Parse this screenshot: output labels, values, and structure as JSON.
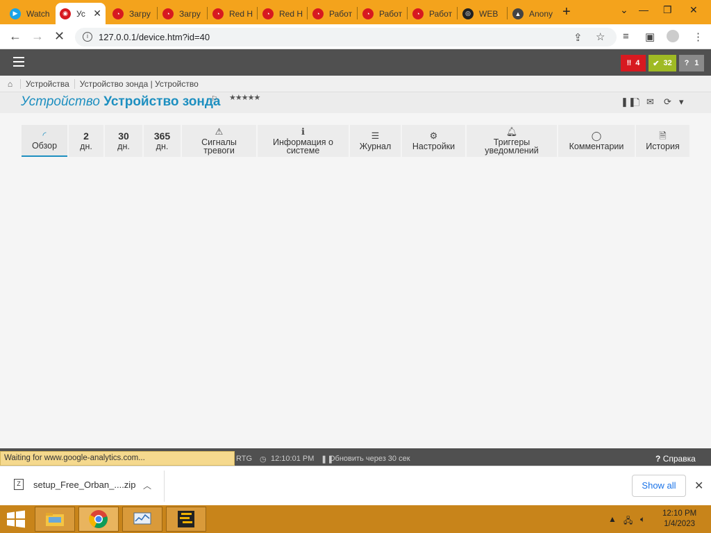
{
  "browser": {
    "tabs": [
      {
        "label": "Watch",
        "icon": "play-icon",
        "color": "#1aa3e8"
      },
      {
        "label": "Ус",
        "icon": "prtg-icon",
        "color": "#d71920"
      },
      {
        "label": "Загру",
        "icon": "prtg-icon",
        "color": "#d71920"
      },
      {
        "label": "Загру",
        "icon": "prtg-icon",
        "color": "#d71920"
      },
      {
        "label": "Red H",
        "icon": "prtg-icon",
        "color": "#d71920"
      },
      {
        "label": "Red H",
        "icon": "prtg-icon",
        "color": "#d71920"
      },
      {
        "label": "Работ",
        "icon": "prtg-icon",
        "color": "#d71920"
      },
      {
        "label": "Работ",
        "icon": "prtg-icon",
        "color": "#d71920"
      },
      {
        "label": "Работ",
        "icon": "prtg-icon",
        "color": "#d71920"
      },
      {
        "label": "WEB",
        "icon": "eye-icon",
        "color": "#222222"
      },
      {
        "label": "Anony",
        "icon": "anon-icon",
        "color": "#444444"
      }
    ],
    "url": "127.0.0.1/device.htm?id=40"
  },
  "header": {
    "alarms": {
      "down": "4",
      "up": "32",
      "unknown": "1"
    }
  },
  "breadcrumb": [
    "Устройства",
    "Устройство зонда | Устройство"
  ],
  "page": {
    "title_prefix": "Устройство",
    "title_name": "Устройство зонда",
    "stars": "★★★★★"
  },
  "tabs": [
    {
      "icon": "gauge-icon",
      "label": "Обзор"
    },
    {
      "num": "2",
      "label": "дн."
    },
    {
      "num": "30",
      "label": "дн."
    },
    {
      "num": "365",
      "label": "дн."
    },
    {
      "icon": "warning-icon",
      "label1": "Сигналы",
      "label2": "тревоги"
    },
    {
      "icon": "info-icon",
      "label1": "Информация о",
      "label2": "системе"
    },
    {
      "icon": "log-icon",
      "label": "Журнал"
    },
    {
      "icon": "gear-icon",
      "label": "Настройки"
    },
    {
      "icon": "bell-icon",
      "label1": "Триггеры",
      "label2": "уведомлений"
    },
    {
      "icon": "comment-icon",
      "label": "Комментарии"
    },
    {
      "icon": "history-icon",
      "label": "История"
    }
  ],
  "footer": {
    "status_message": "Waiting for www.google-analytics.com...",
    "prtg": "RTG",
    "time": "12:10:01 PM",
    "refresh": "Обновить через 30 сек",
    "help": "Справка"
  },
  "downloads": {
    "file": "setup_Free_Orban_....zip",
    "show_all": "Show all"
  },
  "taskbar": {
    "time": "12:10 PM",
    "date": "1/4/2023"
  }
}
